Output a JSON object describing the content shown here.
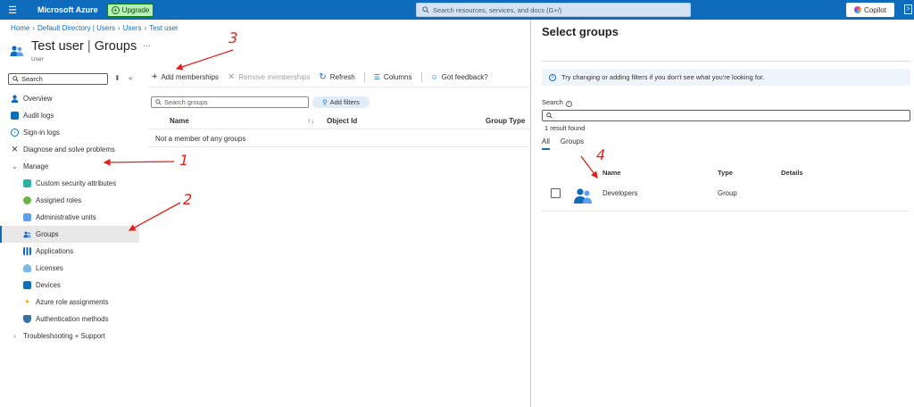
{
  "topbar": {
    "brand": "Microsoft Azure",
    "upgrade_label": "Upgrade",
    "search_placeholder": "Search resources, services, and docs (G+/)",
    "copilot_label": "Copilot"
  },
  "breadcrumb": [
    "Home",
    "Default Directory | Users",
    "Users",
    "Test user"
  ],
  "page": {
    "title_main": "Test user",
    "title_section": "Groups",
    "title_separator": "|",
    "more": "···",
    "subtitle": "User"
  },
  "sidebar": {
    "search_placeholder": "Search",
    "items": [
      {
        "label": "Overview",
        "icon": "person-icon"
      },
      {
        "label": "Audit logs",
        "icon": "book-icon"
      },
      {
        "label": "Sign-in logs",
        "icon": "signin-icon"
      },
      {
        "label": "Diagnose and solve problems",
        "icon": "wrench-icon"
      },
      {
        "label": "Manage",
        "icon": "chevron-down-icon"
      },
      {
        "label": "Custom security attributes",
        "icon": "attributes-icon"
      },
      {
        "label": "Assigned roles",
        "icon": "roles-icon"
      },
      {
        "label": "Administrative units",
        "icon": "admin-units-icon"
      },
      {
        "label": "Groups",
        "icon": "groups-icon"
      },
      {
        "label": "Applications",
        "icon": "apps-grid-icon"
      },
      {
        "label": "Licenses",
        "icon": "license-icon"
      },
      {
        "label": "Devices",
        "icon": "device-icon"
      },
      {
        "label": "Azure role assignments",
        "icon": "key-icon"
      },
      {
        "label": "Authentication methods",
        "icon": "shield-icon"
      },
      {
        "label": "Troubleshooting + Support",
        "icon": "chevron-right-icon"
      }
    ]
  },
  "toolbar": {
    "add": "Add memberships",
    "remove": "Remove memberships",
    "refresh": "Refresh",
    "columns": "Columns",
    "feedback": "Got feedback?"
  },
  "groups_panel": {
    "search_placeholder": "Search groups",
    "add_filters": "Add filters",
    "columns": [
      "Name",
      "Object Id",
      "Group Type"
    ],
    "empty_message": "Not a member of any groups"
  },
  "select_groups": {
    "title": "Select groups",
    "info": "Try changing or adding filters if you don't see what you're looking for.",
    "search_label": "Search",
    "search_value": "",
    "result_count": "1 result found",
    "tabs": [
      "All",
      "Groups"
    ],
    "columns": [
      "Name",
      "Type",
      "Details"
    ],
    "rows": [
      {
        "name": "Developers",
        "type": "Group",
        "details": ""
      }
    ]
  },
  "annotations": [
    "1",
    "2",
    "3",
    "4"
  ],
  "colors": {
    "accent": "#0f6cbd",
    "annotation": "#e0201b",
    "selected_bg": "#e8e8e8"
  }
}
